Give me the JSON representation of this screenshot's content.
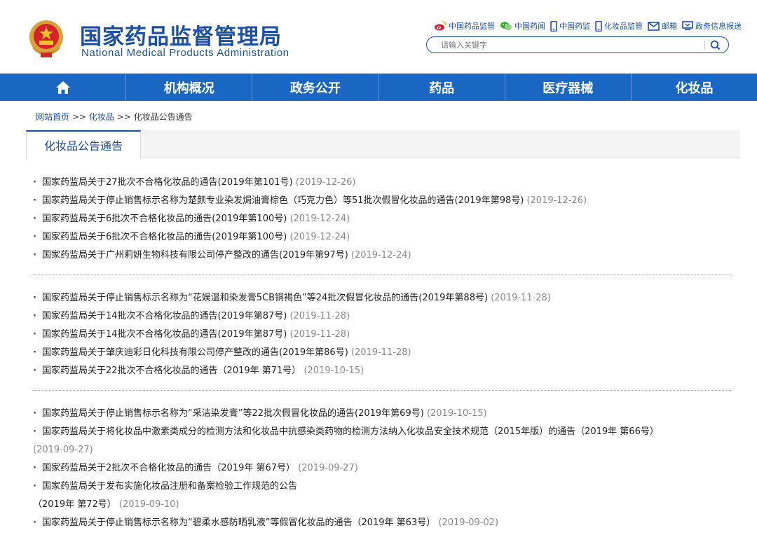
{
  "header": {
    "title_cn": "国家药品监督管理局",
    "title_en": "National Medical Products Administration",
    "links": [
      {
        "label": "中国药品监管",
        "icon": "weibo-icon"
      },
      {
        "label": "中国药闻",
        "icon": "wechat-icon"
      },
      {
        "label": "中国药监",
        "icon": "mobile-icon"
      },
      {
        "label": "化妆品监管",
        "icon": "mobile-icon"
      },
      {
        "label": "邮箱",
        "icon": "mail-icon"
      },
      {
        "label": "政务信息报送",
        "icon": "monitor-icon"
      }
    ],
    "search": {
      "placeholder": "请输入关键字",
      "icon": "search-icon"
    }
  },
  "nav": {
    "home_icon": "home-icon",
    "items": [
      "机构概况",
      "政务公开",
      "药品",
      "医疗器械",
      "化妆品"
    ]
  },
  "breadcrumb": {
    "home": "网站首页",
    "sep1": ">>",
    "section": "化妆品",
    "sep2": ">>",
    "current": "化妆品公告通告"
  },
  "tab": {
    "label": "化妆品公告通告"
  },
  "colors": {
    "brand_blue": "#1b4fa3",
    "nav_blue": "#1967c2",
    "date_gray": "#888888"
  },
  "groups": [
    {
      "items": [
        {
          "title": "国家药监局关于27批次不合格化妆品的通告(2019年第101号)",
          "date": "(2019-12-26)"
        },
        {
          "title": "国家药监局关于停止销售标示名称为楚颜专业染发焗油膏棕色（巧克力色）等51批次假冒化妆品的通告(2019年第98号)",
          "date": "(2019-12-26)"
        },
        {
          "title": "国家药监局关于6批次不合格化妆品的通告(2019年第100号)",
          "date": "(2019-12-24)"
        },
        {
          "title": "国家药监局关于6批次不合格化妆品的通告(2019年第100号)",
          "date": "(2019-12-24)"
        },
        {
          "title": "国家药监局关于广州莉妍生物科技有限公司停产整改的通告(2019年第97号)",
          "date": "(2019-12-24)"
        }
      ]
    },
    {
      "items": [
        {
          "title": "国家药监局关于停止销售标示名称为“花娱温和染发膏5CB铜褐色”等24批次假冒化妆品的通告(2019年第88号)",
          "date": "(2019-11-28)"
        },
        {
          "title": "国家药监局关于14批次不合格化妆品的通告(2019年第87号)",
          "date": "(2019-11-28)"
        },
        {
          "title": "国家药监局关于14批次不合格化妆品的通告(2019年第87号)",
          "date": "(2019-11-28)"
        },
        {
          "title": "国家药监局关于肇庆迪彩日化科技有限公司停产整改的通告(2019年第86号)",
          "date": "(2019-11-28)"
        },
        {
          "title": "国家药监局关于22批次不合格化妆品的通告（2019年 第71号）",
          "date": "(2019-10-15)"
        }
      ]
    },
    {
      "items": [
        {
          "title": "国家药监局关于停止销售标示名称为“采洁染发膏”等22批次假冒化妆品的通告(2019年第69号)",
          "date": "(2019-10-15)"
        },
        {
          "title": "国家药监局关于将化妆品中激素类成分的检测方法和化妆品中抗感染类药物的检测方法纳入化妆品安全技术规范（2015年版）的通告（2019年 第66号）",
          "date": "(2019-09-27)"
        },
        {
          "title": "国家药监局关于2批次不合格化妆品的通告（2019年 第67号）",
          "date": "(2019-09-27)"
        },
        {
          "title": "国家药监局关于发布实施化妆品注册和备案检验工作规范的公告",
          "title2": "（2019年 第72号）",
          "date": "(2019-09-10)"
        },
        {
          "title": "国家药监局关于停止销售标示名称为“碧柔水感防晒乳液”等假冒化妆品的通告（2019年 第63号）",
          "date": "(2019-09-02)"
        }
      ]
    }
  ]
}
